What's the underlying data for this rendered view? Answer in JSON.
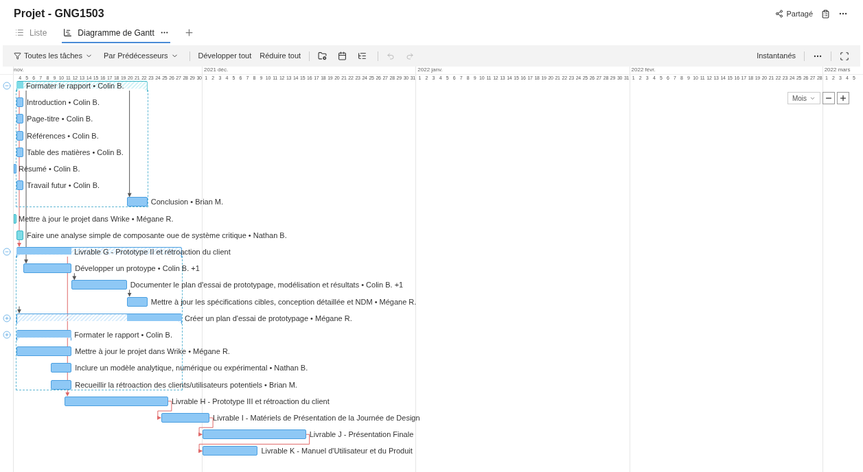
{
  "title": "Projet - GNG1503",
  "share_label": "Partagé",
  "tabs": [
    {
      "label": "Liste",
      "kind": "list",
      "selected": false
    },
    {
      "label": "Diagramme de Gantt",
      "kind": "gantt",
      "selected": true
    }
  ],
  "toolbar": {
    "filters": [
      {
        "label": "Toutes les tâches",
        "kind": "filter"
      },
      {
        "label": "Par Prédécesseurs",
        "kind": "plain"
      }
    ],
    "actions": [
      "Développer tout",
      "Réduire tout"
    ],
    "history": [
      {
        "kind": "undo",
        "disabled": true
      },
      {
        "kind": "redo",
        "disabled": true
      }
    ],
    "snapshots": "Instantanés"
  },
  "timeline": {
    "months": [
      {
        "label": "nov.",
        "days": [
          "4",
          "5",
          "6",
          "7",
          "8",
          "9",
          "10",
          "11",
          "12",
          "13",
          "14",
          "15",
          "16",
          "17",
          "18",
          "19",
          "20",
          "21",
          "22",
          "23",
          "24",
          "25",
          "26",
          "27",
          "28",
          "29",
          "30"
        ]
      },
      {
        "label": "2021 déc.",
        "days": [
          "1",
          "2",
          "3",
          "4",
          "5",
          "6",
          "7",
          "8",
          "9",
          "10",
          "11",
          "12",
          "13",
          "14",
          "15",
          "16",
          "17",
          "18",
          "19",
          "20",
          "21",
          "22",
          "23",
          "24",
          "25",
          "26",
          "27",
          "28",
          "29",
          "30",
          "31"
        ]
      },
      {
        "label": "2022 janv.",
        "days": [
          "1",
          "2",
          "3",
          "4",
          "5",
          "6",
          "7",
          "8",
          "9",
          "10",
          "11",
          "12",
          "13",
          "14",
          "15",
          "16",
          "17",
          "18",
          "19",
          "20",
          "21",
          "22",
          "23",
          "24",
          "25",
          "26",
          "27",
          "28",
          "29",
          "30",
          "31"
        ]
      },
      {
        "label": "2022 févr.",
        "days": [
          "1",
          "2",
          "3",
          "4",
          "5",
          "6",
          "7",
          "8",
          "9",
          "10",
          "11",
          "12",
          "13",
          "14",
          "15",
          "16",
          "17",
          "18",
          "19",
          "20",
          "21",
          "22",
          "23",
          "24",
          "25",
          "26",
          "27",
          "28"
        ]
      },
      {
        "label": "2022 mars",
        "days": [
          "1",
          "2",
          "3",
          "4",
          "5"
        ]
      }
    ]
  },
  "zoom": {
    "scale": "Mois"
  },
  "tasks": [
    {
      "label": "Formater le rapport • Colin B.",
      "kind": "summary",
      "color": "#7fdbe6",
      "expanded": true,
      "children": [
        {
          "label": "Introduction • Colin B.",
          "kind": "task",
          "color": "#8ec8f5"
        },
        {
          "label": "Page-titre • Colin B.",
          "kind": "task",
          "color": "#8ec8f5"
        },
        {
          "label": "Références • Colin B.",
          "kind": "task",
          "color": "#8ec8f5"
        },
        {
          "label": "Table des matières • Colin B.",
          "kind": "task",
          "color": "#8ec8f5"
        },
        {
          "label": "Résumé • Colin B.",
          "kind": "milestone",
          "color": "#8ec8f5"
        },
        {
          "label": "Travail futur • Colin B.",
          "kind": "task",
          "color": "#8ec8f5"
        },
        {
          "label": "Conclusion • Brian M.",
          "kind": "task",
          "color": "#8ec8f5"
        }
      ]
    },
    {
      "label": "Mettre à jour le projet dans Wrike • Mégane R.",
      "kind": "milestone",
      "color": "#7fdbe6"
    },
    {
      "label": "Faire une analyse simple de composante oue de système critique • Nathan B.",
      "kind": "task",
      "color": "#7fdbe6"
    },
    {
      "label": "Livrable G - Prototype II et rétroaction du client",
      "kind": "summary",
      "color": "#8ec8f5",
      "expanded": true,
      "children": [
        {
          "label": "Développer un protoype • Colin B. +1",
          "kind": "task",
          "color": "#8ec8f5"
        },
        {
          "label": "Documenter le plan d'essai de prototypage, modélisation et résultats • Colin B. +1",
          "kind": "task",
          "color": "#8ec8f5"
        },
        {
          "label": "Mettre à jour les spécifications cibles, conception détaillée et NDM • Mégane R.",
          "kind": "task",
          "color": "#8ec8f5"
        },
        {
          "label": "Créer un plan d'essai de prototypage • Mégane R.",
          "kind": "summary",
          "color": "#8ec8f5",
          "expanded": false
        },
        {
          "label": "Formater le rapport • Colin B.",
          "kind": "summary",
          "color": "#8ec8f5",
          "expanded": false
        },
        {
          "label": "Mettre à jour le projet dans Wrike • Mégane R.",
          "kind": "task",
          "color": "#8ec8f5"
        },
        {
          "label": "Inclure un modèle analytique, numérique ou expérimental • Nathan B.",
          "kind": "task",
          "color": "#8ec8f5"
        },
        {
          "label": "Recueillir la rétroaction des clients/utilisateurs potentiels • Brian M.",
          "kind": "task",
          "color": "#8ec8f5"
        }
      ]
    },
    {
      "label": "Livrable H - Prototype III et rétroaction du client",
      "kind": "task",
      "color": "#8ec8f5"
    },
    {
      "label": "Livrable I - Matériels de Présentation de la Journée de Design",
      "kind": "task",
      "color": "#8ec8f5"
    },
    {
      "label": "Livrable J - Présentation Finale",
      "kind": "task",
      "color": "#8ec8f5"
    },
    {
      "label": "Livrable K - Manuel d'Utilisateur et du Produit",
      "kind": "task",
      "color": "#8ec8f5"
    }
  ]
}
